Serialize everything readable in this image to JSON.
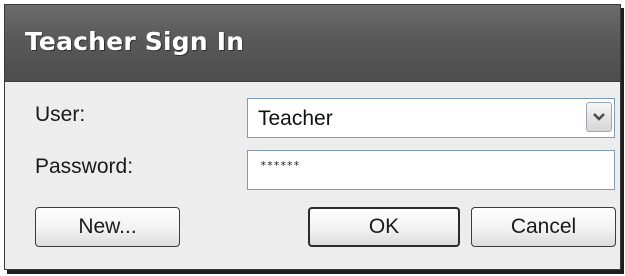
{
  "dialog": {
    "title": "Teacher Sign In"
  },
  "user": {
    "label": "User:",
    "value": "Teacher",
    "dropdown_icon": "chevron-down-icon"
  },
  "password": {
    "label": "Password:",
    "masked_value": "******"
  },
  "buttons": {
    "new_label": "New...",
    "ok_label": "OK",
    "cancel_label": "Cancel"
  }
}
